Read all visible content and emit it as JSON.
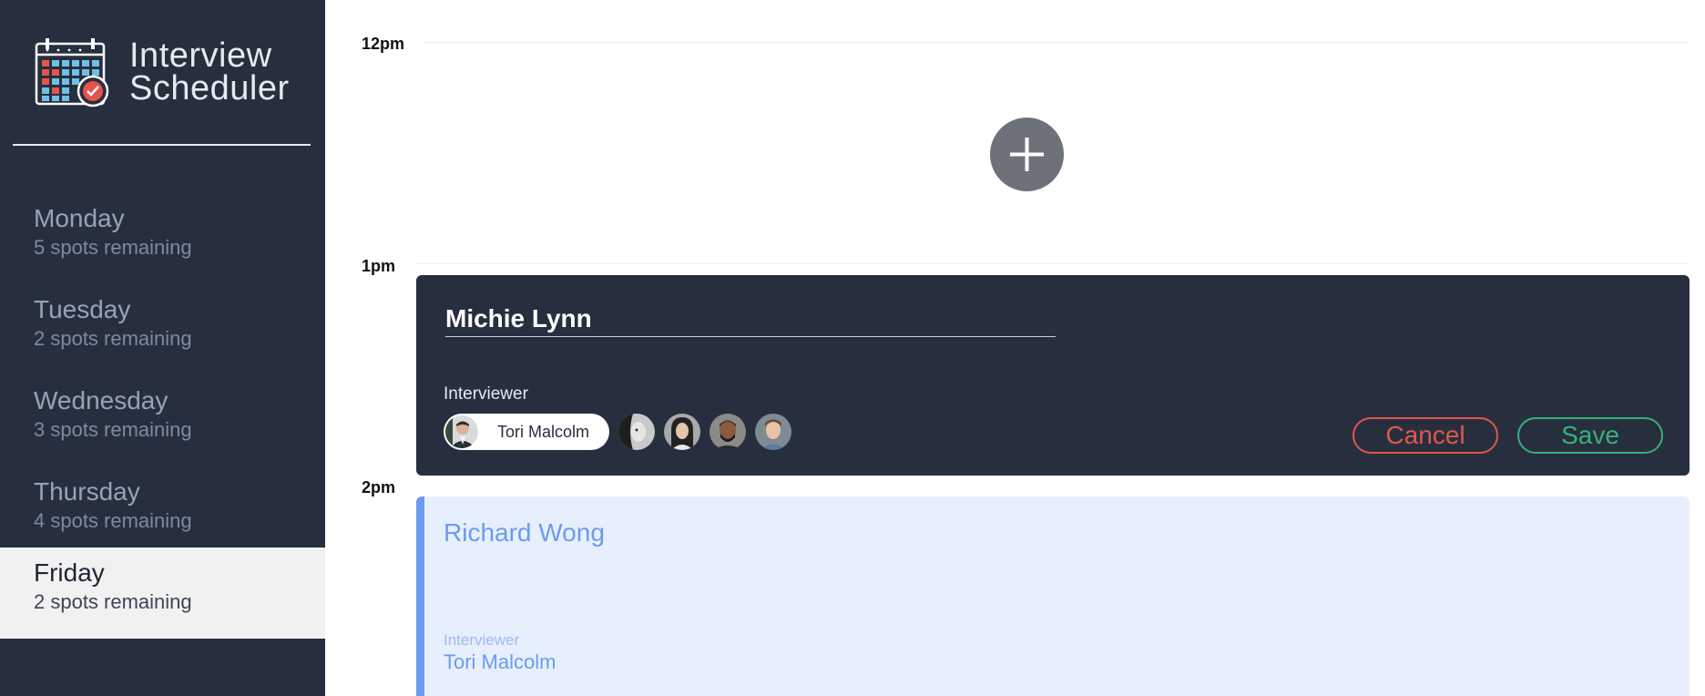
{
  "app": {
    "title_line1": "Interview",
    "title_line2": "Scheduler"
  },
  "sidebar": {
    "days": [
      {
        "name": "Monday",
        "spots": "5 spots remaining",
        "selected": false
      },
      {
        "name": "Tuesday",
        "spots": "2 spots remaining",
        "selected": false
      },
      {
        "name": "Wednesday",
        "spots": "3 spots remaining",
        "selected": false
      },
      {
        "name": "Thursday",
        "spots": "4 spots remaining",
        "selected": false
      },
      {
        "name": "Friday",
        "spots": "2 spots remaining",
        "selected": true
      }
    ]
  },
  "schedule": {
    "times": [
      "12pm",
      "1pm",
      "2pm"
    ]
  },
  "form": {
    "student_name": "Michie Lynn",
    "interviewer_label": "Interviewer",
    "selected_interviewer": "Tori Malcolm",
    "cancel_label": "Cancel",
    "save_label": "Save"
  },
  "appointment": {
    "student": "Richard Wong",
    "interviewer_label": "Interviewer",
    "interviewer": "Tori Malcolm"
  },
  "colors": {
    "sidebar_bg": "#272f3f",
    "cancel": "#e2574c",
    "save": "#37b07c",
    "appointment_accent": "#6b9bf0",
    "appointment_bg": "#e7effc"
  }
}
